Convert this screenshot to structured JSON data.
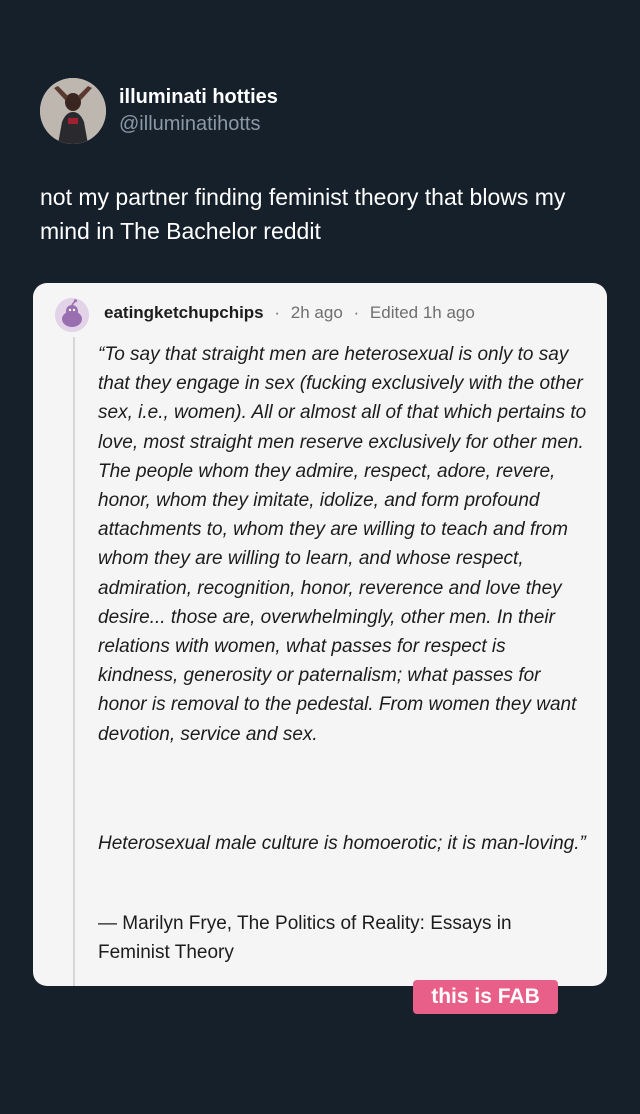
{
  "tweet": {
    "display_name": "illuminati hotties",
    "handle": "@illuminatihotts",
    "text": "not my partner finding feminist theory that blows my mind in The Bachelor reddit"
  },
  "comment": {
    "username": "eatingketchupchips",
    "separator": "·",
    "time": "2h ago",
    "edited": "Edited 1h ago",
    "quote_paragraph_1": "“To say that straight men are heterosexual is only to say that they engage in sex (fucking exclusively with the other sex, i.e., women). All or almost all of that which pertains to love, most straight men reserve exclusively for other men. The people whom they admire, respect, adore, revere, honor, whom they imitate, idolize, and form profound attachments to, whom they are willing to teach and from whom they are willing to learn, and whose respect, admiration, recognition, honor, reverence and love they desire... those are, overwhelmingly, other men. In their relations with women, what passes for respect is kindness, generosity or paternalism; what passes for honor is removal to the pedestal. From women they want devotion, service and sex.",
    "quote_paragraph_2": "Heterosexual male culture is homoerotic; it is man-loving.”",
    "attribution": "— Marilyn Frye, The Politics of Reality: Essays in Feminist Theory"
  },
  "sticker": {
    "text": "this is FAB"
  },
  "colors": {
    "background": "#15202b",
    "card": "#f5f5f5",
    "sticker": "#e8608a",
    "handle": "#8b98a5"
  }
}
